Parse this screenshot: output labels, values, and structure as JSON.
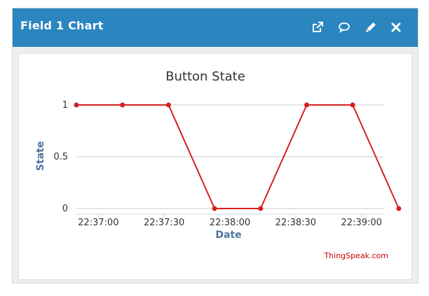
{
  "widget": {
    "title": "Field 1 Chart",
    "icons": [
      "external-link-icon",
      "comment-icon",
      "pencil-icon",
      "close-icon"
    ]
  },
  "chart_data": {
    "type": "line",
    "title": "Button State",
    "xlabel": "Date",
    "ylabel": "State",
    "x_ticks": [
      "22:37:00",
      "22:37:30",
      "22:38:00",
      "22:38:30",
      "22:39:00"
    ],
    "y_ticks": [
      "0",
      "0.5",
      "1"
    ],
    "ylim": [
      0,
      1
    ],
    "xlim": [
      "22:36:50",
      "22:39:10"
    ],
    "series": [
      {
        "color": "#d62020",
        "points": [
          {
            "x": "22:36:50",
            "y": 1
          },
          {
            "x": "22:37:11",
            "y": 1
          },
          {
            "x": "22:37:32",
            "y": 1
          },
          {
            "x": "22:37:53",
            "y": 0
          },
          {
            "x": "22:38:14",
            "y": 0
          },
          {
            "x": "22:38:35",
            "y": 1
          },
          {
            "x": "22:38:56",
            "y": 1
          },
          {
            "x": "22:39:17",
            "y": 0
          }
        ]
      }
    ],
    "grid": true,
    "credit": "ThingSpeak.com",
    "credit_color": "#cc0000",
    "grid_color": "#cccccc",
    "text_color": "#333333",
    "axis_title_color": "#4d759e"
  }
}
